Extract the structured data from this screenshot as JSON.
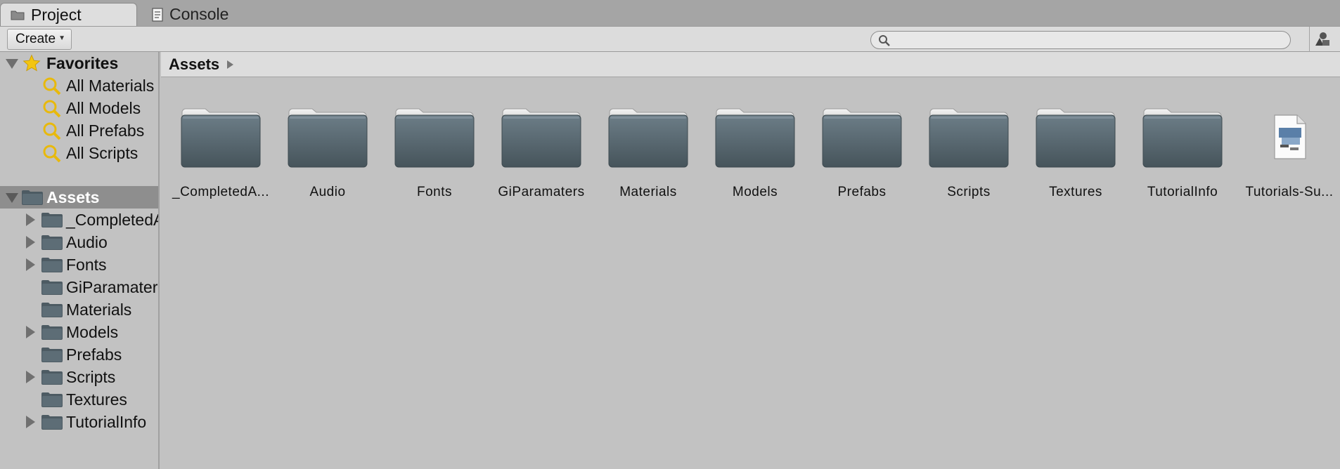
{
  "tabs": [
    {
      "label": "Project",
      "icon": "folder-icon",
      "active": true
    },
    {
      "label": "Console",
      "icon": "console-icon",
      "active": false
    }
  ],
  "toolbar": {
    "create_label": "Create",
    "search_value": "",
    "search_icon": "search-icon",
    "filter_icon": "filter-by-type-icon"
  },
  "sidebar": {
    "favorites": {
      "label": "Favorites",
      "items": [
        "All Materials",
        "All Models",
        "All Prefabs",
        "All Scripts"
      ]
    },
    "assets": {
      "label": "Assets",
      "items": [
        {
          "label": "_CompletedA",
          "expandable": true
        },
        {
          "label": "Audio",
          "expandable": true
        },
        {
          "label": "Fonts",
          "expandable": true
        },
        {
          "label": "GiParamater",
          "expandable": false
        },
        {
          "label": "Materials",
          "expandable": false
        },
        {
          "label": "Models",
          "expandable": true
        },
        {
          "label": "Prefabs",
          "expandable": false
        },
        {
          "label": "Scripts",
          "expandable": true
        },
        {
          "label": "Textures",
          "expandable": false
        },
        {
          "label": "TutorialInfo",
          "expandable": true
        }
      ]
    }
  },
  "main": {
    "breadcrumb": "Assets",
    "items": [
      {
        "label": "_CompletedA...",
        "type": "folder"
      },
      {
        "label": "Audio",
        "type": "folder"
      },
      {
        "label": "Fonts",
        "type": "folder"
      },
      {
        "label": "GiParamaters",
        "type": "folder"
      },
      {
        "label": "Materials",
        "type": "folder"
      },
      {
        "label": "Models",
        "type": "folder"
      },
      {
        "label": "Prefabs",
        "type": "folder"
      },
      {
        "label": "Scripts",
        "type": "folder"
      },
      {
        "label": "Textures",
        "type": "folder"
      },
      {
        "label": "TutorialInfo",
        "type": "folder"
      },
      {
        "label": "Tutorials-Su...",
        "type": "document"
      }
    ]
  },
  "colors": {
    "background": "#c2c2c2",
    "toolbar": "#dcdcdc",
    "selected_row": "#8e8e8e",
    "folder": "#55656e",
    "star": "#f3c511",
    "search_favorite": "#e8b90c"
  }
}
